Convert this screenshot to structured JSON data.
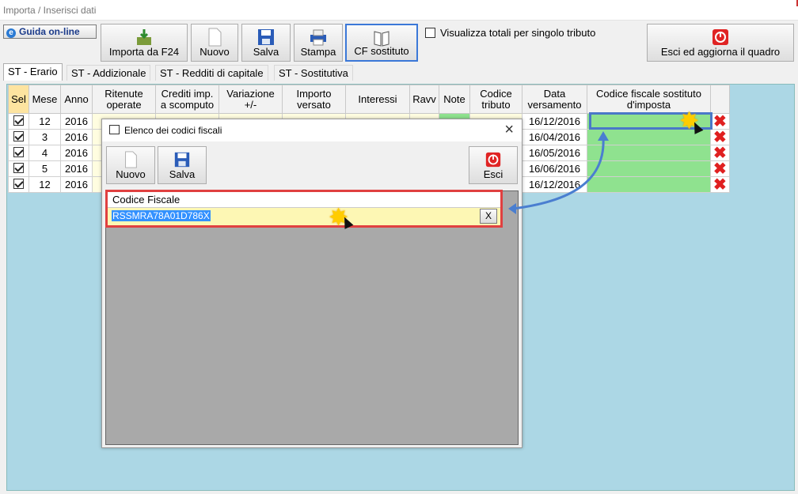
{
  "window": {
    "title": "Importa / Inserisci dati"
  },
  "toolbar": {
    "guida": "Guida on-line",
    "importa": "Importa da F24",
    "nuovo": "Nuovo",
    "salva": "Salva",
    "stampa": "Stampa",
    "cf": "CF sostituto",
    "visualizza": "Visualizza totali per singolo tributo",
    "esci": "Esci ed aggiorna il quadro"
  },
  "tabs": [
    "ST - Erario",
    "ST - Addizionale",
    "ST - Redditi di capitale",
    "ST - Sostitutiva"
  ],
  "grid": {
    "headers": [
      "Sel",
      "Mese",
      "Anno",
      "Ritenute operate",
      "Crediti imp. a scomputo",
      "Variazione +/-",
      "Importo versato",
      "Interessi",
      "Ravv",
      "Note",
      "Codice tributo",
      "Data versamento",
      "Codice fiscale sostituto d'imposta"
    ],
    "rows": [
      {
        "mese": "12",
        "anno": "2016",
        "data": "16/12/2016"
      },
      {
        "mese": "3",
        "anno": "2016",
        "data": "16/04/2016"
      },
      {
        "mese": "4",
        "anno": "2016",
        "data": "16/05/2016"
      },
      {
        "mese": "5",
        "anno": "2016",
        "data": "16/06/2016"
      },
      {
        "mese": "12",
        "anno": "2016",
        "data": "16/12/2016"
      }
    ]
  },
  "dialog": {
    "title": "Elenco dei codici fiscali",
    "nuovo": "Nuovo",
    "salva": "Salva",
    "esci": "Esci",
    "column": "Codice Fiscale",
    "value": "RSSMRA78A01D786X",
    "clear": "X"
  },
  "colors": {
    "accent": "#3b78d8",
    "panel": "#acd7e5",
    "green": "#8fe28f",
    "highlight": "#e04040"
  }
}
